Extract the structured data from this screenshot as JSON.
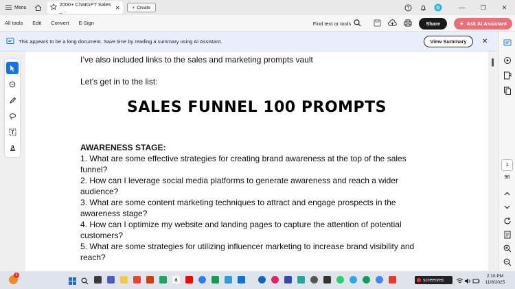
{
  "titlebar": {
    "menu_label": "Menu",
    "tab_title": "2000+ ChatGPT Sales _...",
    "create_label": "Create"
  },
  "toolbar": {
    "tabs": [
      "All tools",
      "Edit",
      "Convert",
      "E-Sign"
    ],
    "find_label": "Find text or tools",
    "share_label": "Share",
    "ai_label": "Ask AI Assistant"
  },
  "banner": {
    "text": "This appears to be a long document. Save time by reading a summary using AI Assistant.",
    "button_label": "View Summary"
  },
  "document": {
    "intro_1": "I’ve also included links to the sales and marketing prompts vault",
    "intro_2": "Let’s get in to the list:",
    "heading": "SALES FUNNEL 100 PROMPTS",
    "stage_title": "AWARENESS STAGE:",
    "items": [
      "1. What are some effective strategies for creating brand awareness at the top of the sales funnel?",
      "2. How can I leverage social media platforms to generate awareness and reach a wider audience?",
      "3. What are some content marketing techniques to attract and engage prospects in the awareness stage?",
      "4. How can I optimize my website and landing pages to capture the attention of potential customers?",
      "5. What are some strategies for utilizing influencer marketing to increase brand visibility and reach?"
    ]
  },
  "pagination": {
    "current_page": "1",
    "total_pages": "96"
  },
  "taskbar": {
    "weather_badge": "5",
    "screenrec_label": "screenrec",
    "time": "2:10 PM",
    "date": "11/8/2025"
  },
  "colors": {
    "accent": "#1473e6",
    "ai_button": "#ea6f7b",
    "banner_bg": "#e8effa"
  }
}
